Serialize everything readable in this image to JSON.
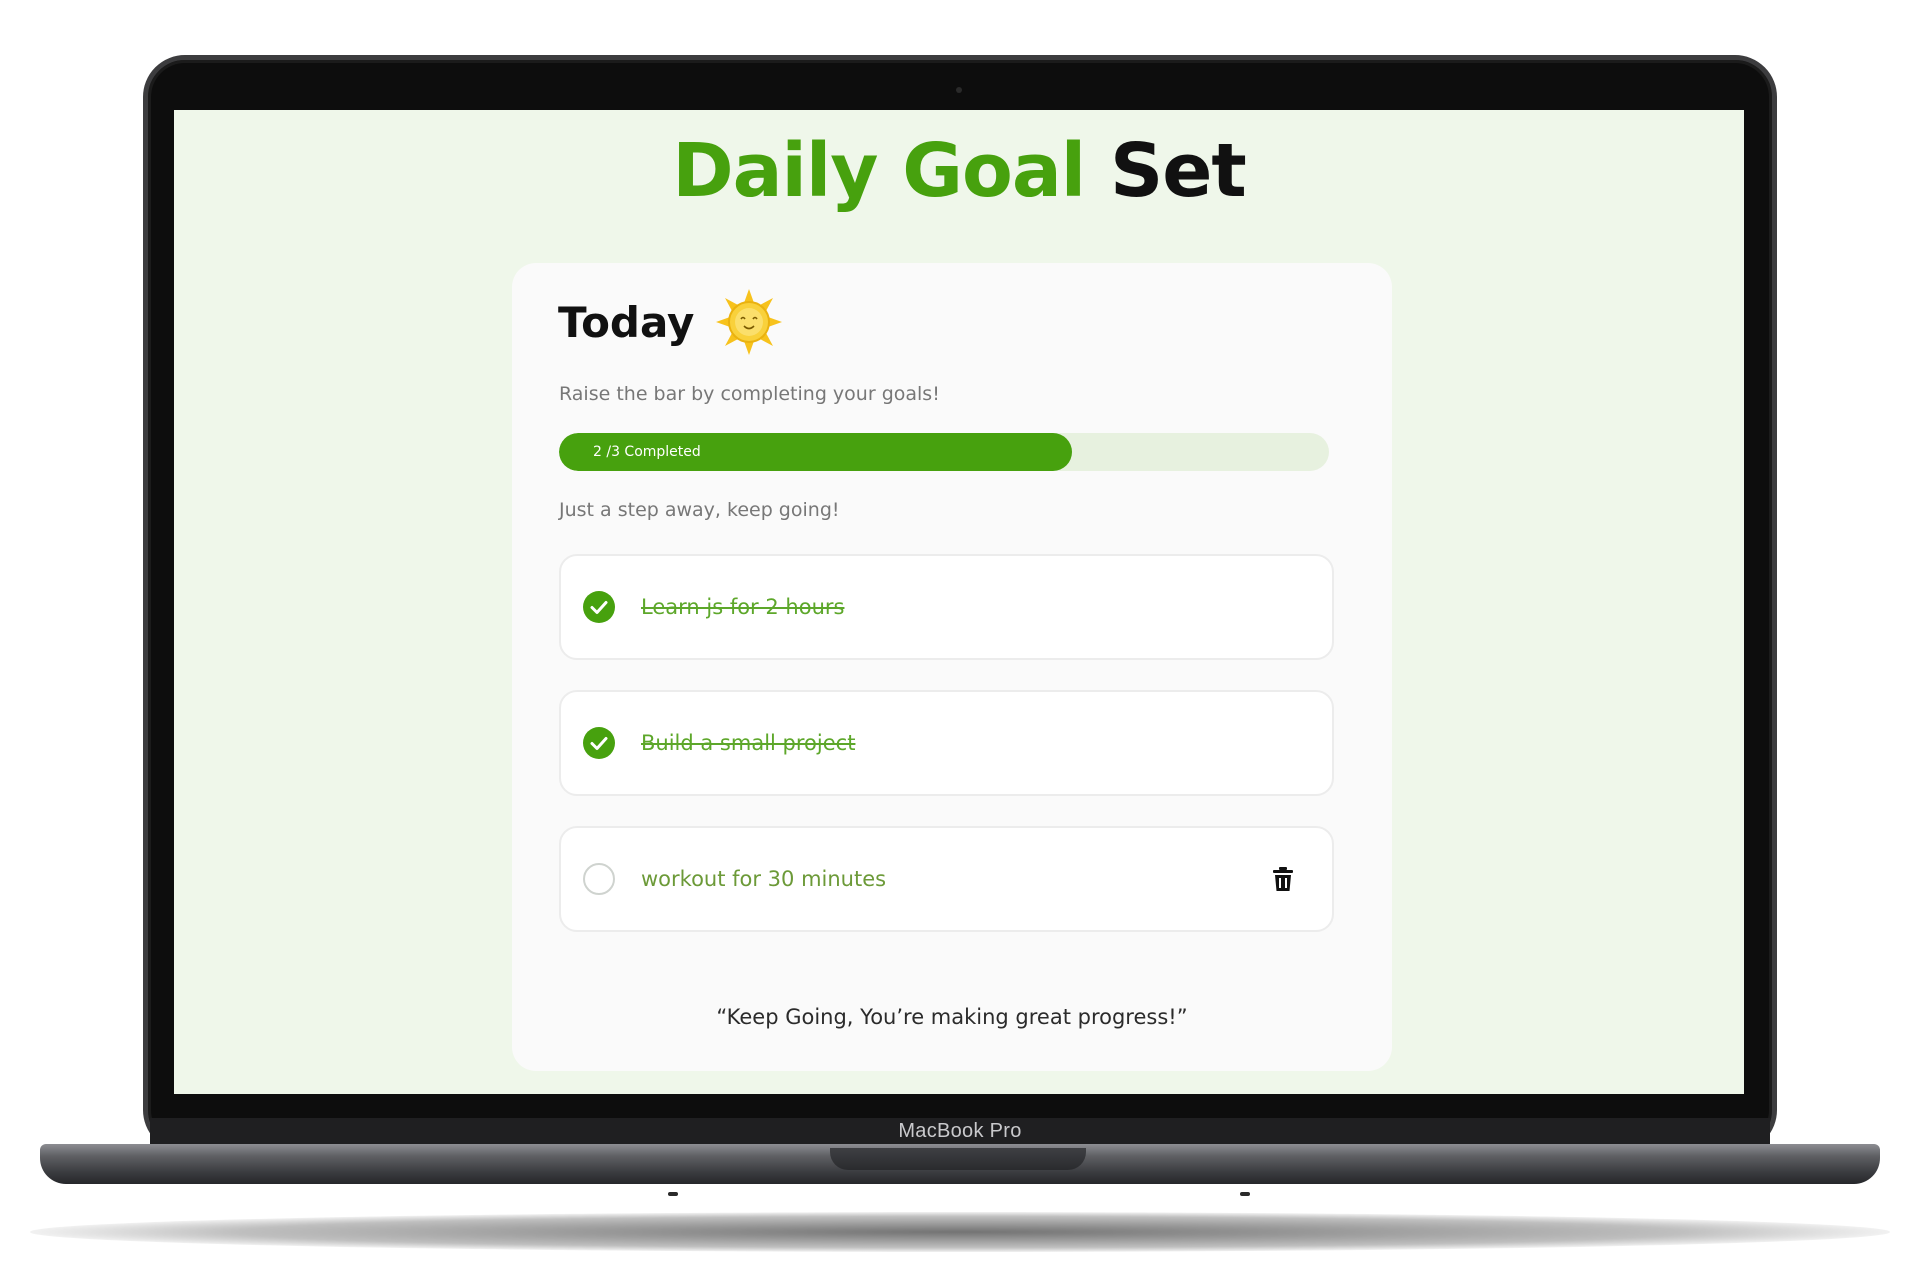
{
  "device": {
    "model_label": "MacBook Pro"
  },
  "app": {
    "title_accent": "Daily Goal",
    "title_rest": "Set",
    "accent_color": "#47a10e"
  },
  "card": {
    "heading": "Today",
    "heading_icon": "smiling-sun-icon",
    "subtitle": "Raise the bar by completing your goals!",
    "progress": {
      "label": "2 /3 Completed",
      "completed": 2,
      "total": 3
    },
    "encouragement": "Just a step away, keep going!",
    "goals": [
      {
        "text": "Learn js for 2 hours",
        "done": true
      },
      {
        "text": "Build a small project",
        "done": true
      },
      {
        "text": "workout for 30 minutes",
        "done": false,
        "action_icon": "trash-icon"
      }
    ],
    "quote": "“Keep Going, You’re making great progress!”"
  }
}
